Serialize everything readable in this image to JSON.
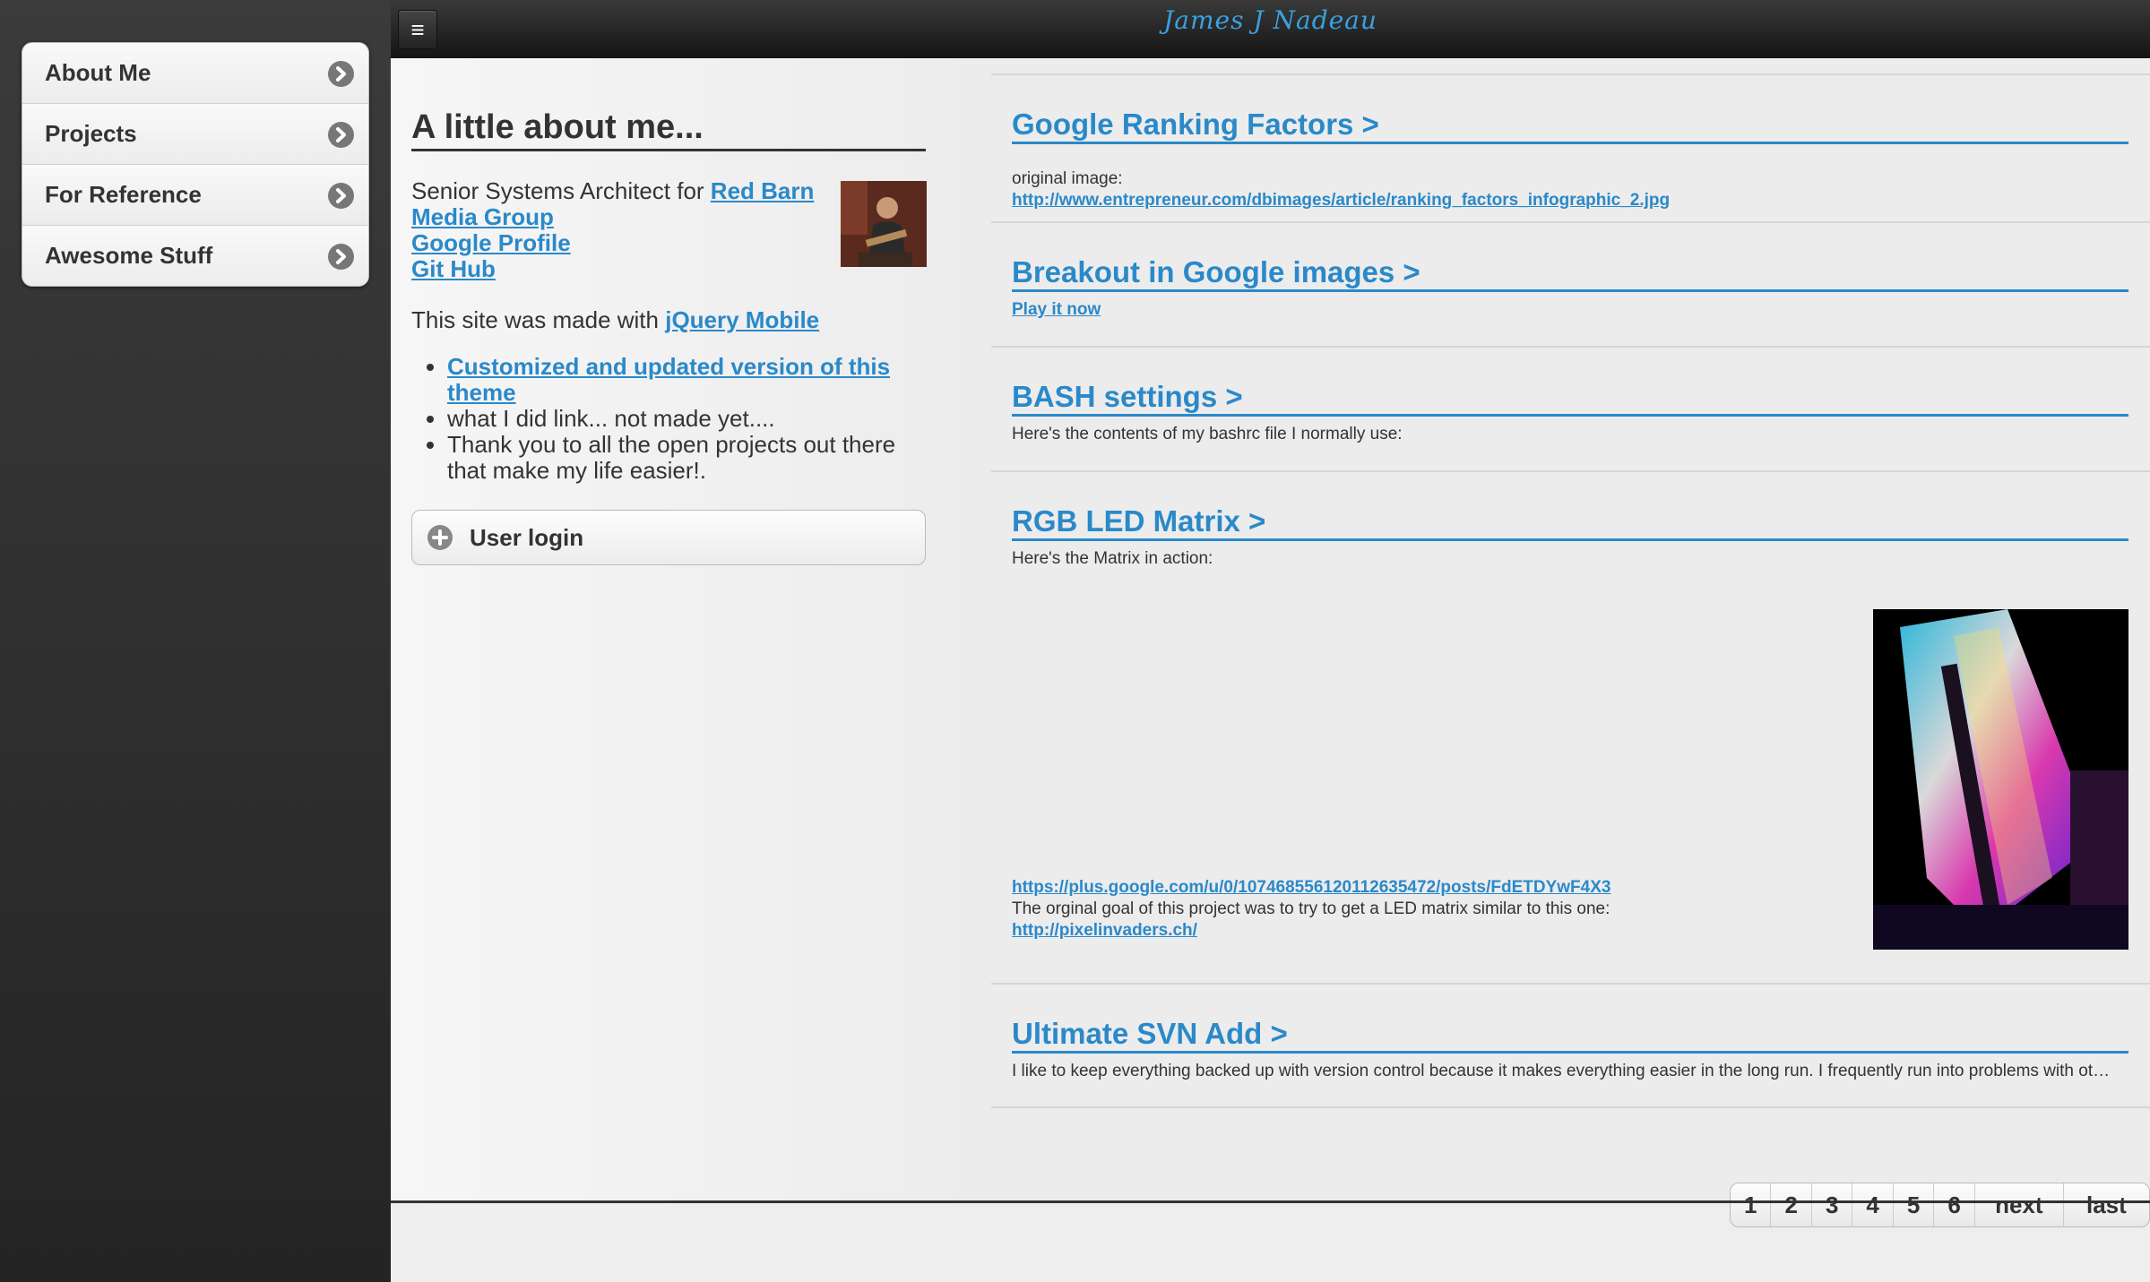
{
  "header": {
    "site_title": "James J Nadeau",
    "menu_button_glyph": "≡"
  },
  "panel_menu": {
    "items": [
      {
        "label": "About Me"
      },
      {
        "label": "Projects"
      },
      {
        "label": "For Reference"
      },
      {
        "label": "Awesome Stuff"
      }
    ]
  },
  "about": {
    "title": "A little about me...",
    "intro_text": "Senior Systems Architect for ",
    "company_link": "Red Barn Media Group",
    "google_profile_link": "Google Profile",
    "github_link": "Git Hub",
    "made_with_text": "This site was made with ",
    "jquery_link": "jQuery Mobile",
    "notes": {
      "theme_link": "Customized and updated version of this theme",
      "what_i_did": "what I did link... not made yet....",
      "thanks": "Thank you to all the open projects out there that make my life easier!."
    },
    "login_label": "User login"
  },
  "articles": [
    {
      "title": "Google Ranking Factors >",
      "text": "original image:",
      "link": "http://www.entrepreneur.com/dbimages/article/ranking_factors_infographic_2.jpg"
    },
    {
      "title": "Breakout in Google images >",
      "link": "Play it now"
    },
    {
      "title": "BASH settings >",
      "text": "Here's the contents of my bashrc file I normally use:"
    },
    {
      "title": "RGB LED Matrix >",
      "text": "Here's the Matrix in action:",
      "link": "https://plus.google.com/u/0/107468556120112635472/posts/FdETDYwF4X3",
      "text2": "The orginal goal of this project was to try to get a LED matrix similar to this one:",
      "link2": "http://pixelinvaders.ch/"
    },
    {
      "title": "Ultimate SVN Add >",
      "text": "I like to keep everything backed up with version control because it makes everything easier in the long run. I frequently run into problems with ot…"
    }
  ],
  "pager": {
    "pages": [
      "1",
      "2",
      "3",
      "4",
      "5",
      "6"
    ],
    "next": "next ›",
    "last": "last »"
  }
}
